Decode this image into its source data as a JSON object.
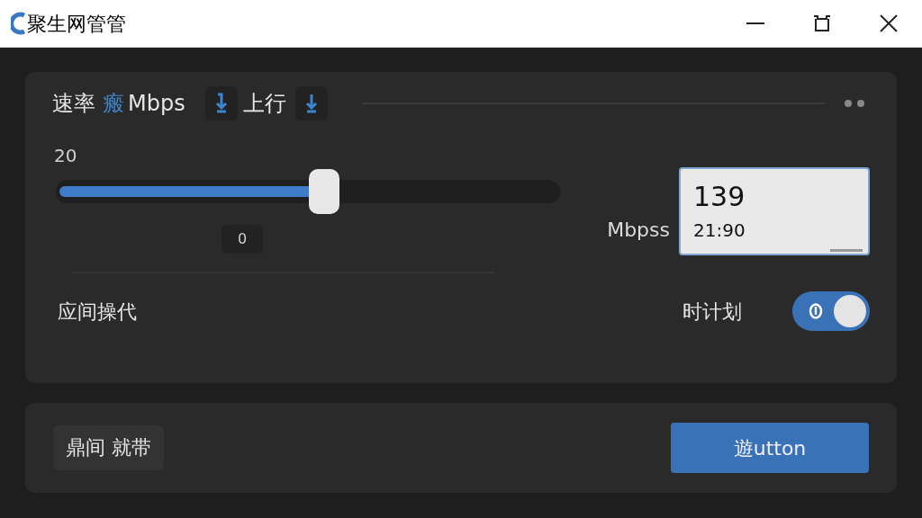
{
  "window": {
    "title": "聚生网管管"
  },
  "rate_header": {
    "label": "速率",
    "value": "瘢",
    "unit": "Mbps",
    "direction_label": "上行"
  },
  "slider": {
    "max_label": "20",
    "level": 0.53,
    "value_label": "0"
  },
  "readout": {
    "unit": "Mbpss",
    "value": "139",
    "time": "21:90"
  },
  "option": {
    "label": "应间操代",
    "toggle_label": "时计划",
    "on": true
  },
  "footer": {
    "tag": "鼎间 就带",
    "button": "遊utton"
  }
}
